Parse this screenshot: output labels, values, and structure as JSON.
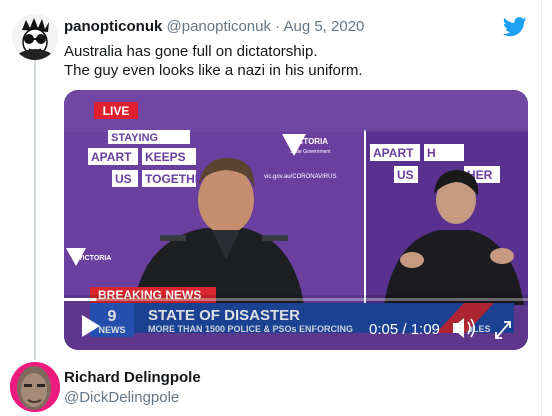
{
  "tweet": {
    "display_name": "panopticonuk",
    "handle": "@panopticonuk",
    "separator": "·",
    "date": "Aug 5, 2020",
    "text_line1": "Australia has gone full on dictatorship.",
    "text_line2": "The guy even looks like a nazi in his uniform.",
    "platform_icon": "twitter-bird-icon"
  },
  "video": {
    "live_badge": "LIVE",
    "sign_words": [
      "STAYING",
      "APART",
      "KEEPS",
      "US",
      "TOGETHER"
    ],
    "sign_words_right": [
      "APART",
      "H",
      "US",
      "HER"
    ],
    "victoria_label": "VICTORIA",
    "victoria_sub": "State Government",
    "website": "vic.gov.au/CORONAVIRUS",
    "channel_logo_top": "9",
    "channel_logo_bottom": "NEWS",
    "breaking_label": "BREAKING NEWS",
    "headline": "STATE OF DISASTER",
    "subheadline": "MORE THAN 1500 POLICE & PSOs ENFORCING",
    "subheadline_tail": "RULES",
    "time_display": "0:05 / 1:09",
    "progress_fraction": 0.07,
    "colors": {
      "purple": "#6a3fa2",
      "live_red": "#e0202e",
      "breaking_red": "#d7262e",
      "lower_third_blue": "#1f4aa8"
    }
  },
  "reply_user": {
    "display_name": "Richard Delingpole",
    "handle": "@DickDelingpole"
  },
  "colors": {
    "twitter_blue": "#1da1f2",
    "muted": "#657786",
    "text": "#14171a"
  }
}
